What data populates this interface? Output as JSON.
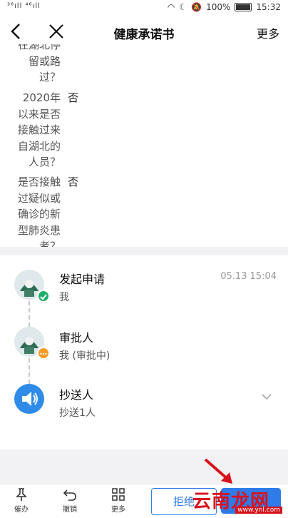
{
  "status_bar": {
    "signal_text": "³⁶ıll ⁴⁶ıll",
    "battery": "100%",
    "time": "15:32"
  },
  "nav": {
    "title": "健康承诺书",
    "more_label": "更多"
  },
  "form": {
    "rows": [
      {
        "label_lines": [
          "在湖北停",
          "留或路",
          "过？"
        ],
        "value": ""
      },
      {
        "label_lines": [
          "2020年",
          "以来是否",
          "接触过来",
          "自湖北的",
          "人员？"
        ],
        "value": "否"
      },
      {
        "label_lines": [
          "是否接触",
          "过疑似或",
          "确诊的新",
          "型肺炎患",
          "者？"
        ],
        "value": "否"
      }
    ]
  },
  "flow": {
    "steps": [
      {
        "title": "发起申请",
        "subtitle": "我",
        "time": "05.13 15:04",
        "status": "done"
      },
      {
        "title": "审批人",
        "subtitle": "我 (审批中)",
        "time": "",
        "status": "pending"
      },
      {
        "title": "抄送人",
        "subtitle": "抄送1人",
        "time": "",
        "status": "cc"
      }
    ]
  },
  "toolbar": {
    "items": [
      {
        "icon": "pin-icon",
        "label": "催办"
      },
      {
        "icon": "undo-icon",
        "label": "撤销"
      },
      {
        "icon": "grid-icon",
        "label": "更多"
      }
    ],
    "reject_label": "拒绝"
  },
  "watermark": {
    "logo_text": "云南龙网",
    "url_text": "www.ynl.com"
  },
  "colors": {
    "primary": "#2f7bea",
    "done_badge": "#1fae6a",
    "pending_badge": "#f59a23",
    "watermark_red": "#d8121b"
  }
}
